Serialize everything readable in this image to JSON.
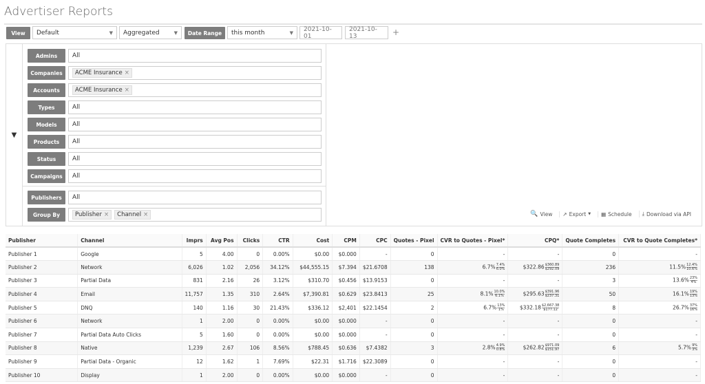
{
  "title": "Advertiser Reports",
  "toolbar": {
    "view_label": "View",
    "view_value": "Default",
    "mode_value": "Aggregated",
    "date_range_label": "Date Range",
    "date_range_value": "this month",
    "start_date": "2021-10-01",
    "end_date": "2021-10-13",
    "add": "+"
  },
  "filters": [
    {
      "label": "Admins",
      "value": "All",
      "tags": []
    },
    {
      "label": "Companies",
      "value": "",
      "tags": [
        "ACME Insurance"
      ]
    },
    {
      "label": "Accounts",
      "value": "",
      "tags": [
        "ACME Insurance"
      ]
    },
    {
      "label": "Types",
      "value": "All",
      "tags": []
    },
    {
      "label": "Models",
      "value": "All",
      "tags": []
    },
    {
      "label": "Products",
      "value": "All",
      "tags": []
    },
    {
      "label": "Status",
      "value": "All",
      "tags": []
    },
    {
      "label": "Campaigns",
      "value": "All",
      "tags": []
    },
    {
      "label": "Publishers",
      "value": "All",
      "tags": []
    },
    {
      "label": "Group By",
      "value": "",
      "tags": [
        "Publisher",
        "Channel"
      ]
    }
  ],
  "actions": {
    "view": "View",
    "export": "Export",
    "schedule": "Schedule",
    "download": "Download via API"
  },
  "table": {
    "columns": [
      "Publisher",
      "Channel",
      "Imprs",
      "Avg Pos",
      "Clicks",
      "CTR",
      "Cost",
      "CPM",
      "CPC",
      "Quotes - Pixel",
      "CVR to Quotes - Pixel*",
      "CPQ*",
      "Quote Completes",
      "CVR to Quote Completes*"
    ],
    "rows": [
      [
        "Publisher 1",
        "Google",
        "5",
        "4.00",
        "0",
        "0.00%",
        "$0.00",
        "$0.000",
        "-",
        "0",
        [
          "-",
          "",
          ""
        ],
        [
          "-",
          "",
          ""
        ],
        "0",
        [
          "-",
          "",
          ""
        ]
      ],
      [
        "Publisher 2",
        "Network",
        "6,026",
        "1.02",
        "2,056",
        "34.12%",
        "$44,555.15",
        "$7.394",
        "$21.6708",
        "138",
        [
          "6.7%",
          "7.4%",
          "6.0%"
        ],
        [
          "$322.86",
          "$360.89",
          "$292.09"
        ],
        "236",
        [
          "11.5%",
          "12.4%",
          "10.6%"
        ]
      ],
      [
        "Publisher 3",
        "Partial Data",
        "831",
        "2.16",
        "26",
        "3.12%",
        "$310.70",
        "$0.456",
        "$13.9153",
        "0",
        [
          "-",
          "",
          ""
        ],
        [
          "-",
          "",
          ""
        ],
        "3",
        [
          "13.6%",
          "23%",
          "4%"
        ]
      ],
      [
        "Publisher 4",
        "Email",
        "11,757",
        "1.35",
        "310",
        "2.64%",
        "$7,390.81",
        "$0.629",
        "$23.8413",
        "25",
        [
          "8.1%",
          "10.0%",
          "6.1%"
        ],
        [
          "$295.63",
          "$391.96",
          "$237.31"
        ],
        "50",
        [
          "16.1%",
          "19%",
          "13%"
        ]
      ],
      [
        "Publisher 5",
        "DNQ",
        "140",
        "1.16",
        "30",
        "21.43%",
        "$336.12",
        "$2,401",
        "$22.1454",
        "2",
        [
          "6.7%",
          "13%",
          "1%"
        ],
        [
          "$332.18",
          "$2,667.38",
          "$177.12"
        ],
        "8",
        [
          "26.7%",
          "37%",
          "16%"
        ]
      ],
      [
        "Publisher 6",
        "Network",
        "1",
        "2.00",
        "0",
        "0.00%",
        "$0.00",
        "$0.000",
        "-",
        "0",
        [
          "-",
          "",
          ""
        ],
        [
          "-",
          "",
          ""
        ],
        "0",
        [
          "-",
          "",
          ""
        ]
      ],
      [
        "Publisher 7",
        "Partial Data Auto Clicks",
        "5",
        "1.60",
        "0",
        "0.00%",
        "$0.00",
        "$0.000",
        "-",
        "0",
        [
          "-",
          "",
          ""
        ],
        [
          "-",
          "",
          ""
        ],
        "0",
        [
          "-",
          "",
          ""
        ]
      ],
      [
        "Publisher 8",
        "Native",
        "1,239",
        "2.67",
        "106",
        "8.56%",
        "$788.45",
        "$0.636",
        "$7.4382",
        "3",
        [
          "2.8%",
          "4.9%",
          "0.8%"
        ],
        [
          "$262.82",
          "$971.09",
          "$151.97"
        ],
        "6",
        [
          "5.7%",
          "9%",
          "3%"
        ]
      ],
      [
        "Publisher 9",
        "Partial Data - Organic",
        "12",
        "1.62",
        "1",
        "7.69%",
        "$22.31",
        "$1.716",
        "$22.3089",
        "0",
        [
          "-",
          "",
          ""
        ],
        [
          "-",
          "",
          ""
        ],
        "0",
        [
          "-",
          "",
          ""
        ]
      ],
      [
        "Publisher 10",
        "Display",
        "1",
        "2.00",
        "0",
        "0.00%",
        "$0.00",
        "$0.000",
        "-",
        "0",
        [
          "-",
          "",
          ""
        ],
        [
          "-",
          "",
          ""
        ],
        "0",
        [
          "-",
          "",
          ""
        ]
      ]
    ]
  }
}
